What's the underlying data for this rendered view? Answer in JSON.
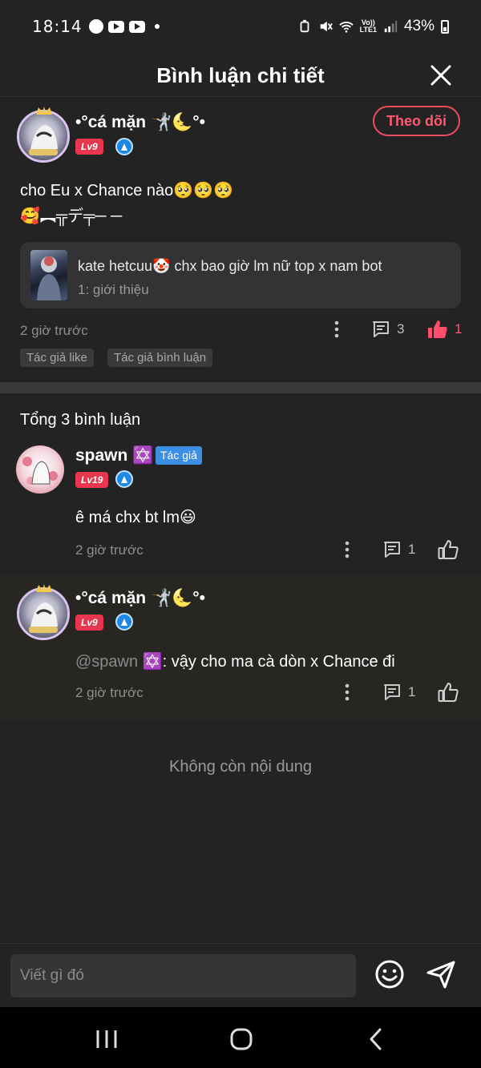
{
  "status_bar": {
    "time": "18:14",
    "network": "LTE1",
    "volte": "Vo))",
    "battery": "43%"
  },
  "header": {
    "title": "Bình luận chi tiết"
  },
  "main_comment": {
    "username": "•°cá mặn 🤺🌜°•",
    "level": "Lv9",
    "follow_label": "Theo dõi",
    "text_line1": "cho Eu x Chance nào🥺🥺🥺",
    "text_line2": "🥰︻╦デ╤─ ─",
    "quote": {
      "title": "kate hetcuu🤡 chx bao giờ lm nữ top x nam bot",
      "subtitle": "1: giới thiệu"
    },
    "time": "2 giờ trước",
    "reply_count": "3",
    "like_count": "1",
    "tags": [
      "Tác giả like",
      "Tác giả bình luận"
    ]
  },
  "replies_header": "Tổng 3 bình luận",
  "replies": [
    {
      "username": "spawn ✡️",
      "author_tag": "Tác giả",
      "level": "Lv19",
      "text": "ê má chx bt lm😃",
      "time": "2 giờ trước",
      "reply_count": "1"
    },
    {
      "username": "•°cá mặn 🤺🌜°•",
      "level": "Lv9",
      "mention": "@spawn ✡️",
      "text": ": vậy cho ma cà dòn x Chance đi",
      "time": "2 giờ trước",
      "reply_count": "1"
    }
  ],
  "end_text": "Không còn nội dung",
  "input": {
    "placeholder": "Viết gì đó"
  },
  "colors": {
    "accent": "#f04b63",
    "author_blue": "#3d8fe6",
    "background": "#232323"
  }
}
